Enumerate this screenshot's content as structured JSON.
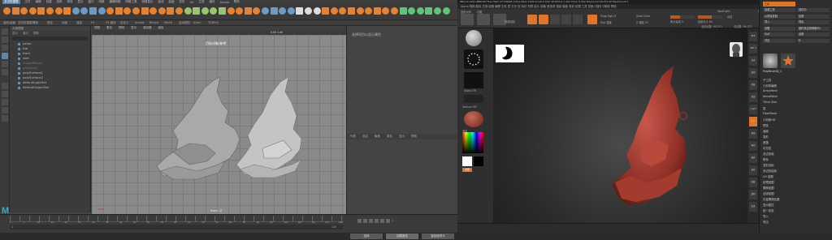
{
  "maya": {
    "menubar": [
      "文件",
      "编辑",
      "创建",
      "选择",
      "修改",
      "显示",
      "窗口",
      "网格",
      "编辑网格",
      "网格工具",
      "网格显示",
      "曲线",
      "曲面",
      "变形",
      "UV",
      "生成",
      "缓存",
      "Arnold",
      "帮助"
    ],
    "menu_selected": "多边形建模",
    "shelf_tabs": [
      "曲线/曲面",
      "多边形建模",
      "雕刻",
      "绑定",
      "动画",
      "渲染",
      "FX",
      "FX 缓存",
      "自定义",
      "Arnold",
      "Bifrost",
      "MASH",
      "运动图形",
      "XGen",
      "TURTLE"
    ],
    "outliner": {
      "title": "大纲视图",
      "toolbar": [
        "显示",
        "展示",
        "帮助"
      ],
      "items": [
        {
          "label": "persp",
          "dim": false
        },
        {
          "label": "top",
          "dim": false
        },
        {
          "label": "front",
          "dim": false
        },
        {
          "label": "side",
          "dim": false
        },
        {
          "label": "imagePlane1",
          "dim": true
        },
        {
          "label": "pSphere1",
          "dim": true
        },
        {
          "label": "polySurface1",
          "dim": false
        },
        {
          "label": "polySurface2",
          "dim": false
        },
        {
          "label": "defaultLightSet",
          "dim": false
        },
        {
          "label": "defaultObjectSet",
          "dim": false
        }
      ]
    },
    "viewport": {
      "menu": [
        "视图",
        "着色",
        "照明",
        "显示",
        "渲染器",
        "面板"
      ],
      "label": "目标对象/参考",
      "camera": "front -Z",
      "stats": "0.00   1.00"
    },
    "attr": {
      "title": "选择项目以显示属性",
      "tabs": [
        "列表",
        "选定",
        "聚焦",
        "属性",
        "显示",
        "帮助"
      ],
      "buttons": [
        "选择",
        "加载属性",
        "复制选项卡"
      ]
    },
    "timeline": {
      "ticks": [
        "1",
        "5",
        "10",
        "15",
        "20",
        "25",
        "30",
        "35",
        "40",
        "45",
        "50",
        "55",
        "60",
        "65",
        "70",
        "75",
        "80",
        "85",
        "90",
        "95",
        "100",
        "105",
        "110",
        "115",
        "120"
      ],
      "range_start": "1",
      "range_end": "120",
      "current": "1",
      "logo": "M"
    }
  },
  "zbrush": {
    "titlebar": "ZBrush 2021  ZBRUSH   Free Mem 47.546GB  Active Mem 1026  Scratch Disk 48  ZTime 1.402  Timer 0.002  PolyCount 90.271 KP  MeshCount 1",
    "menubar": "Alpha 笔刷 颜色 文档 绘图 编辑 文件 层 灯光 宏 标记 材质 影片 拾取 首选项 渲染 模板 笔划 纹理 工具 变换 Z插件 Z脚本 帮助",
    "top": {
      "buttons": [
        "投影大师",
        "灯箱",
        "快速绘图"
      ],
      "modes": [
        "编辑",
        "绘制",
        "移动",
        "缩放",
        "旋转"
      ],
      "mrgb": "Mrgb  Rgb  M",
      "rgb_intensity": "Rgb 强度",
      "zadd": "Zadd  Zsub",
      "focal": "焦点衰减 0",
      "draw_size": "绘制大小 64",
      "z_intensity": "Z 强度 25",
      "dynamic": "动态",
      "active_points": "活动点数: 90,271",
      "total_points": "总点数: 90,271",
      "spotlight": "SpotLight",
      "default_zscript": "DefaultZScript"
    },
    "left": {
      "alpha_label": "Alpha Off",
      "texture_label": "Texture Off",
      "gradient_label": "渐变",
      "swatch": "交换",
      "primary_color": "#ffffff",
      "secondary_color": "#000000"
    },
    "tool": {
      "header": "工具",
      "buttons": [
        "加载工具",
        "另存为",
        "从项目复制",
        "复制",
        "导入",
        "导出",
        "克隆",
        "制作多边形网格3D",
        "GoZ",
        "全部",
        "可见",
        "R"
      ],
      "label_current": "PolyMesh3D_1",
      "items": [
        "子工具",
        "几何体编辑",
        "ArrayMesh",
        "NanoMesh",
        "Thick Skin",
        "层",
        "FiberMesh",
        "几何体HD",
        "预览",
        "曲面",
        "变形",
        "遮罩",
        "可见性",
        "多边形组",
        "联系",
        "变形目标",
        "多边形绘制",
        "UV 贴图",
        "纹理贴图",
        "置换贴图",
        "法线贴图",
        "矢量置换贴图",
        "显示属性",
        "统一蒙皮",
        "导入",
        "导出"
      ]
    },
    "right_shelf": [
      "BPR",
      "SPix 3",
      "动态",
      "透视",
      "地板",
      "局部",
      "L.Sym",
      "Xyz",
      "框架",
      "移动",
      "缩放",
      "旋转",
      "线框",
      "透明",
      "实体"
    ]
  }
}
